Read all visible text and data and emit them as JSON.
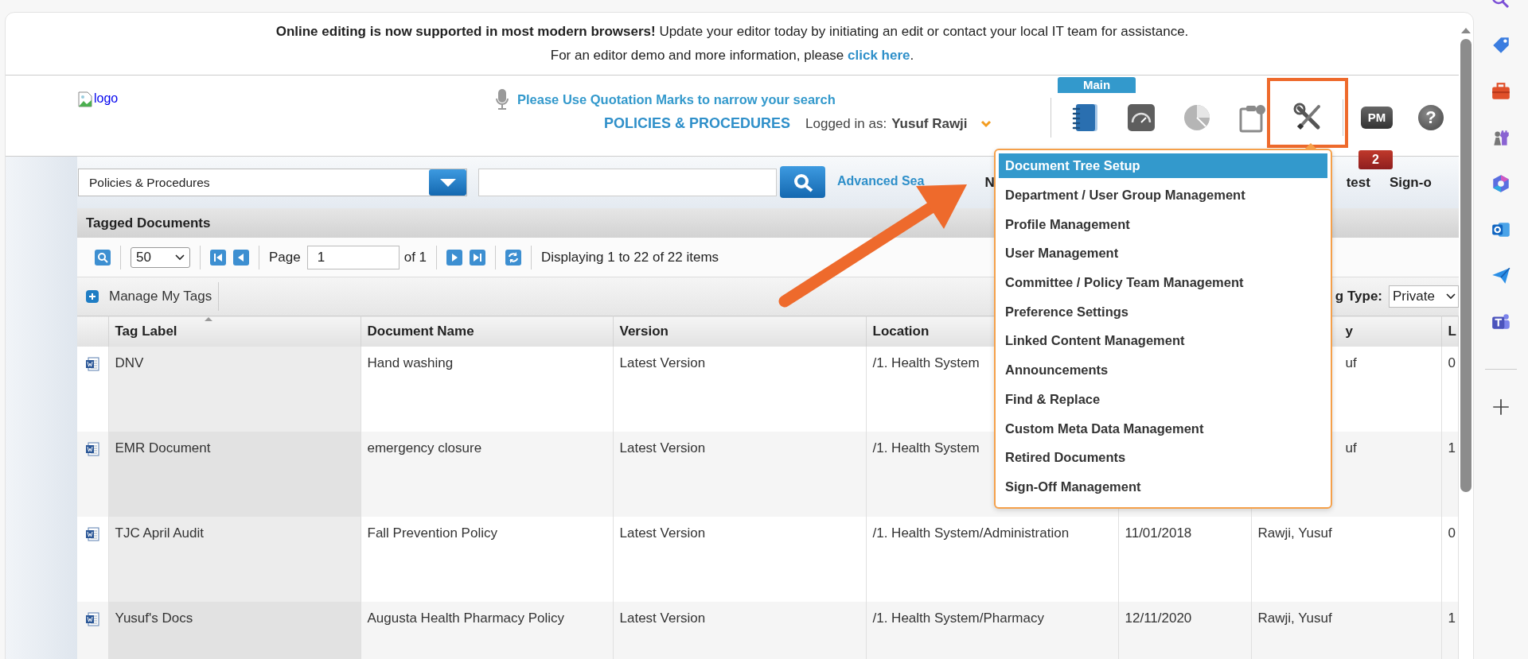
{
  "banner": {
    "line1": "**Online editing is now supported in most modern browsers!** Update your editor today by initiating an edit or contact your local IT team for assistance.",
    "line2": "For an editor demo and more information, please ",
    "link": "click here",
    "line2_end": "."
  },
  "header": {
    "logo_alt": "logo",
    "search_hint": "Please Use Quotation Marks to narrow your search",
    "module": "POLICIES & PROCEDURES",
    "logged_in_label": "Logged in as:",
    "user": "Yusuf Rawji",
    "tab": "Main",
    "tools": [
      {
        "kind": "notebook",
        "highlighted": false
      },
      {
        "kind": "gauge",
        "highlighted": false
      },
      {
        "kind": "pie",
        "highlighted": false
      },
      {
        "kind": "clipboard",
        "highlighted": false
      },
      {
        "kind": "wrench",
        "highlighted": true
      },
      {
        "kind": "pm",
        "label": "PM",
        "badge": "2",
        "highlighted": false
      },
      {
        "kind": "help",
        "label": "?",
        "highlighted": false
      }
    ]
  },
  "search": {
    "scope": "Policies & Procedures",
    "advanced": "Advanced Sea",
    "nav": [
      {
        "text": "N"
      },
      {
        "text": "test"
      },
      {
        "text": "Sign-o"
      }
    ]
  },
  "grid": {
    "title": "Tagged Documents",
    "page_size": "50",
    "page_label": "Page",
    "page": "1",
    "page_of": "of 1",
    "display": "Displaying 1 to 22 of 22 items",
    "manage": "Manage My Tags",
    "tag_type_label": "g Type:",
    "tag_type": "Private",
    "columns": [
      {
        "label": "Tag Label",
        "sorted": true
      },
      {
        "label": "Document Name",
        "sorted": false
      },
      {
        "label": "Version",
        "sorted": false
      },
      {
        "label": "Location",
        "sorted": false
      },
      {},
      {
        "label": "y",
        "sorted": false,
        "clipped": true
      },
      {
        "label": "L",
        "sorted": false
      }
    ],
    "rows": [
      {
        "cells": [
          "DNV",
          "Hand washing",
          "Latest Version",
          "/1. Health System",
          null,
          {
            "text": "uf",
            "clipped": true
          },
          "0"
        ]
      },
      {
        "cells": [
          "EMR Document",
          "emergency closure",
          "Latest Version",
          "/1. Health System",
          null,
          {
            "text": "uf",
            "clipped": true
          },
          "1"
        ]
      },
      {
        "cells": [
          "TJC April Audit",
          "Fall Prevention Policy",
          "Latest Version",
          "/1. Health System/Administration",
          "11/01/2018",
          "Rawji, Yusuf",
          "0"
        ]
      },
      {
        "cells": [
          "Yusuf's Docs",
          "Augusta Health Pharmacy Policy",
          "Latest Version",
          "/1. Health System/Pharmacy",
          "12/11/2020",
          "Rawji, Yusuf",
          "1"
        ]
      }
    ]
  },
  "menu": [
    {
      "label": "Document Tree Setup",
      "selected": true
    },
    {
      "label": "Department / User Group Management",
      "selected": false
    },
    {
      "label": "Profile Management",
      "selected": false
    },
    {
      "label": "User Management",
      "selected": false
    },
    {
      "label": "Committee / Policy Team Management",
      "selected": false
    },
    {
      "label": "Preference Settings",
      "selected": false
    },
    {
      "label": "Linked Content Management",
      "selected": false
    },
    {
      "label": "Announcements",
      "selected": false
    },
    {
      "label": "Find & Replace",
      "selected": false
    },
    {
      "label": "Custom Meta Data Management",
      "selected": false
    },
    {
      "label": "Retired Documents",
      "selected": false
    },
    {
      "label": "Sign-Off Management",
      "selected": false
    }
  ]
}
